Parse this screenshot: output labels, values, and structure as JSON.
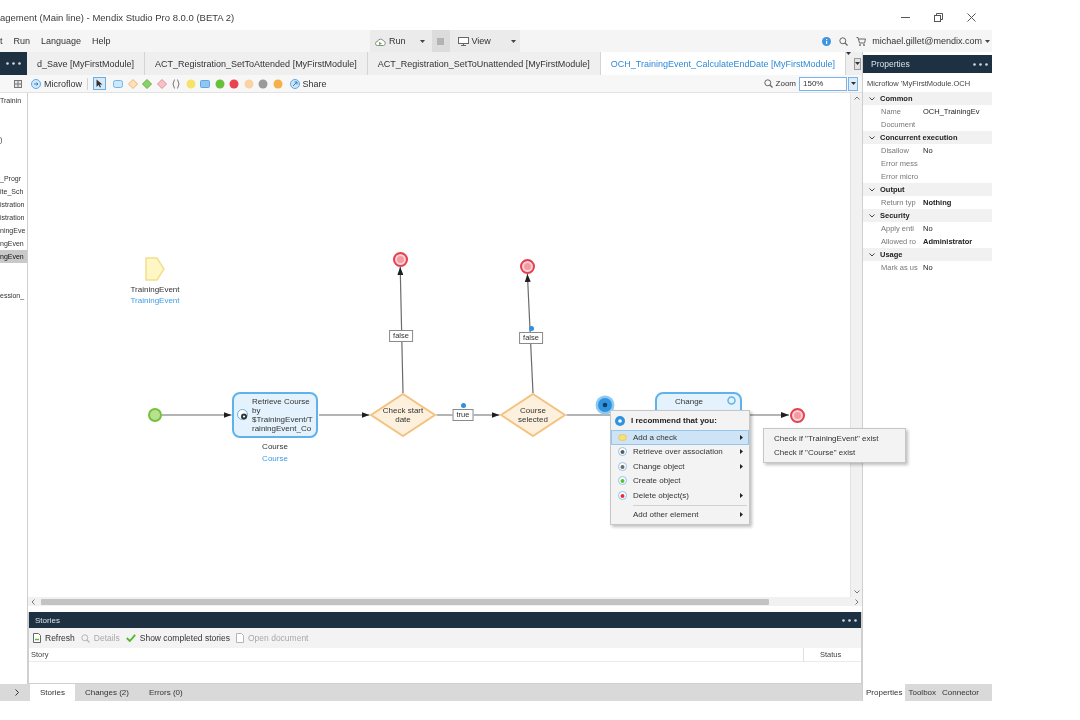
{
  "window": {
    "title": "agement (Main line) - Mendix Studio Pro 8.0.0 (BETA 2)"
  },
  "menu_bar": {
    "items": [
      "t",
      "Run",
      "Language",
      "Help"
    ],
    "run_button": "Run",
    "view_button": "View",
    "account": "michael.gillet@mendix.com"
  },
  "project_explorer": {
    "items": [
      {
        "label": "Trainin",
        "selected": false
      },
      {
        "label": ")",
        "selected": false
      },
      {
        "label": "_Progr",
        "selected": false
      },
      {
        "label": "ite_Sch",
        "selected": false
      },
      {
        "label": "istration",
        "selected": false
      },
      {
        "label": "istration",
        "selected": false
      },
      {
        "label": "ningEve",
        "selected": false
      },
      {
        "label": "ngEven",
        "selected": false
      },
      {
        "label": "ngEven",
        "selected": true
      },
      {
        "label": "ession_",
        "selected": false
      }
    ]
  },
  "document_tabs": [
    {
      "label": "d_Save [MyFirstModule]",
      "selected": false
    },
    {
      "label": "ACT_Registration_SetToAttended [MyFirstModule]",
      "selected": false
    },
    {
      "label": "ACT_Registration_SetToUnattended [MyFirstModule]",
      "selected": false
    },
    {
      "label": "OCH_TrainingEvent_CalculateEndDate [MyFirstModule]",
      "selected": true
    }
  ],
  "editor_toolbar": {
    "document_type": "Microflow",
    "share": "Share",
    "zoom_label": "Zoom",
    "zoom": "150%"
  },
  "microflow": {
    "parameter": {
      "name": "TrainingEvent",
      "type": "TrainingEvent"
    },
    "nodes": [
      {
        "kind": "start"
      },
      {
        "kind": "activity",
        "label": "Retrieve Course by $TrainingEvent/TrainingEvent_Co",
        "output_name": "Course",
        "output_type": "Course"
      },
      {
        "kind": "decision",
        "label": "Check start date"
      },
      {
        "kind": "end"
      },
      {
        "kind": "decision",
        "label": "Course selected"
      },
      {
        "kind": "end"
      },
      {
        "kind": "activity",
        "label": "Change"
      },
      {
        "kind": "end"
      }
    ],
    "flow_labels": [
      "false",
      "true",
      "false"
    ],
    "recommendations": {
      "header": "I recommend that you:",
      "items": [
        {
          "kind": "check",
          "label": "Add a check",
          "selected": true,
          "has_submenu": true,
          "submenu": [
            "Check if \"TrainingEvent\" exist",
            "Check if \"Course\" exist"
          ]
        },
        {
          "kind": "retrieve",
          "label": "Retrieve over association",
          "selected": false,
          "has_submenu": true
        },
        {
          "kind": "change",
          "label": "Change object",
          "selected": false,
          "has_submenu": true
        },
        {
          "kind": "create",
          "label": "Create object",
          "selected": false,
          "has_submenu": false
        },
        {
          "kind": "delete",
          "label": "Delete object(s)",
          "selected": false,
          "has_submenu": true
        },
        {
          "kind": "other",
          "label": "Add other element",
          "selected": false,
          "has_submenu": true
        }
      ]
    }
  },
  "properties": {
    "title": "Properties",
    "subject": "Microflow 'MyFirstModule.OCH",
    "groups": [
      {
        "name": "Common",
        "expanded": true,
        "rows": [
          {
            "label": "Name",
            "value": "OCH_TrainingEv",
            "strong": false
          },
          {
            "label": "Document"
          }
        ]
      },
      {
        "name": "Concurrent execution",
        "expanded": true,
        "rows": [
          {
            "label": "Disallow",
            "value": "No",
            "strong": false
          },
          {
            "label": "Error mess"
          },
          {
            "label": "Error micro"
          }
        ]
      },
      {
        "name": "Output",
        "expanded": true,
        "rows": [
          {
            "label": "Return typ",
            "value": "Nothing",
            "strong": true
          }
        ]
      },
      {
        "name": "Security",
        "expanded": true,
        "rows": [
          {
            "label": "Apply enti",
            "value": "No",
            "strong": false
          },
          {
            "label": "Allowed ro",
            "value": "Administrator",
            "strong": true
          }
        ]
      },
      {
        "name": "Usage",
        "expanded": true,
        "rows": [
          {
            "label": "Mark as us",
            "value": "No",
            "strong": false
          }
        ]
      }
    ]
  },
  "stories_panel": {
    "title": "Stories",
    "actions": [
      {
        "kind": "refresh",
        "label": "Refresh",
        "disabled": false
      },
      {
        "kind": "details",
        "label": "Details",
        "disabled": true
      },
      {
        "kind": "completed",
        "label": "Show completed stories",
        "disabled": false
      },
      {
        "kind": "open",
        "label": "Open document",
        "disabled": true
      }
    ],
    "columns": [
      "Story",
      "Status"
    ]
  },
  "bottom_tabs": [
    {
      "label": "Stories",
      "selected": true
    },
    {
      "label": "Changes (2)",
      "selected": false
    },
    {
      "label": "Errors (0)",
      "selected": false
    }
  ],
  "side_tabs": [
    {
      "label": "Properties",
      "selected": true
    },
    {
      "label": "Toolbox",
      "selected": false
    },
    {
      "label": "Connector",
      "selected": false
    }
  ]
}
